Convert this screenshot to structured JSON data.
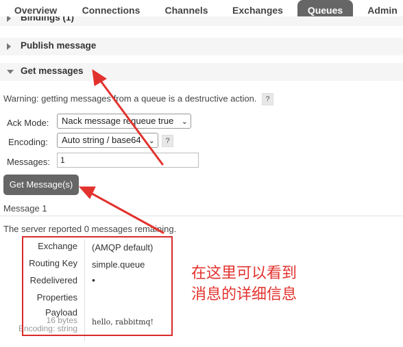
{
  "nav": {
    "tabs": [
      "Overview",
      "Connections",
      "Channels",
      "Exchanges",
      "Queues",
      "Admin"
    ],
    "active": "Queues"
  },
  "sections": {
    "bindings": "Bindings (1)",
    "publish": "Publish message",
    "get": "Get messages"
  },
  "warning": "Warning: getting messages from a queue is a destructive action.",
  "help_glyph": "?",
  "form": {
    "ack_mode_label": "Ack Mode:",
    "ack_mode_value": "Nack message requeue true",
    "encoding_label": "Encoding:",
    "encoding_value": "Auto string / base64",
    "messages_label": "Messages:",
    "messages_value": "1",
    "get_button": "Get Message(s)"
  },
  "result": {
    "message_title": "Message 1",
    "remaining_prefix": "The server reported ",
    "remaining_count": "0",
    "remaining_suffix": " messages remaining.",
    "labels": {
      "exchange": "Exchange",
      "routing_key": "Routing Key",
      "redelivered": "Redelivered",
      "properties": "Properties",
      "payload": "Payload",
      "payload_size": "16 bytes",
      "payload_encoding": "Encoding: string"
    },
    "values": {
      "exchange": "(AMQP default)",
      "routing_key": "simple.queue",
      "redelivered": "•",
      "payload": "hello, rabbitmq!"
    }
  },
  "annotation": {
    "line1": "在这里可以看到",
    "line2": "消息的详细信息"
  },
  "colors": {
    "annotation": "#e2322d",
    "tab_active": "#666666",
    "button": "#666666"
  }
}
